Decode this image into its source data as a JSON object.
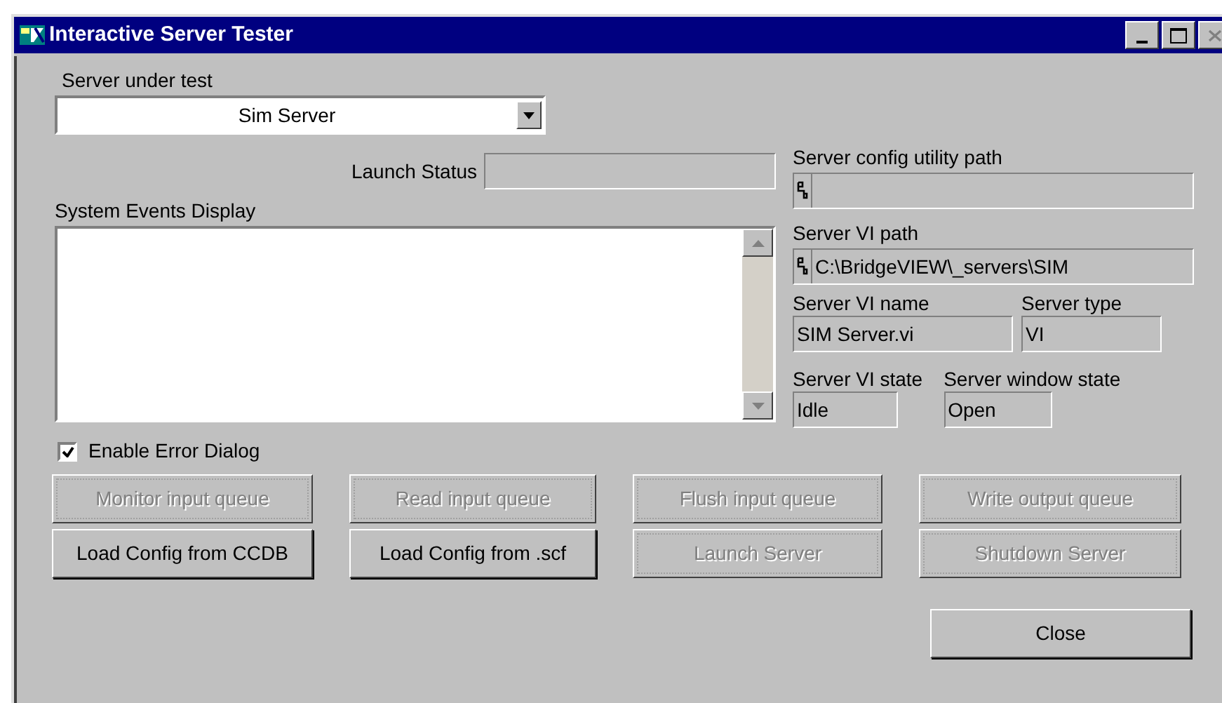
{
  "window": {
    "title": "Interactive Server Tester",
    "close_disabled": true
  },
  "server_under_test": {
    "label": "Server under test",
    "value": "Sim Server"
  },
  "launch_status": {
    "label": "Launch Status"
  },
  "events_display": {
    "label": "System Events Display"
  },
  "config_utility_path": {
    "label": "Server config utility path"
  },
  "vi_path": {
    "label": "Server VI path",
    "value": "C:\\BridgeVIEW\\_servers\\SIM"
  },
  "vi_name": {
    "label": "Server VI name",
    "value": "SIM Server.vi"
  },
  "server_type": {
    "label": "Server type",
    "value": "VI"
  },
  "vi_state": {
    "label": "Server VI state",
    "value": "Idle"
  },
  "window_state": {
    "label": "Server window state",
    "value": "Open"
  },
  "error_dialog": {
    "label": "Enable Error Dialog",
    "checked": true
  },
  "buttons": [
    {
      "label": "Monitor input queue",
      "disabled": true
    },
    {
      "label": "Read input queue",
      "disabled": true
    },
    {
      "label": "Flush input queue",
      "disabled": true
    },
    {
      "label": "Write output queue",
      "disabled": true
    },
    {
      "label": "Load Config from CCDB",
      "disabled": false
    },
    {
      "label": "Load Config from .scf",
      "disabled": false
    },
    {
      "label": "Launch Server",
      "disabled": true
    },
    {
      "label": "Shutdown Server",
      "disabled": true
    }
  ],
  "close_button": {
    "label": "Close"
  }
}
